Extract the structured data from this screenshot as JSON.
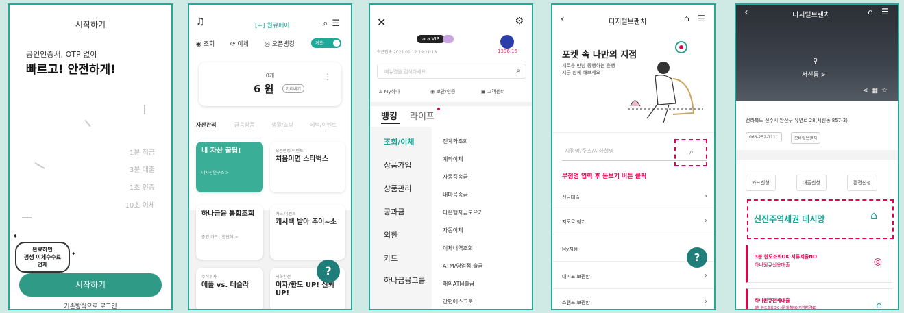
{
  "colors": {
    "accent": "#23a89a",
    "button": "#2f9b87",
    "highlight": "#e0004d",
    "background": "#cfe9e4"
  },
  "screen1": {
    "title": "시작하기",
    "subtitle": "공인인증서, OTP 없이",
    "headline": "빠르고! 안전하게!",
    "timings": [
      "1분 적금",
      "3분 대출",
      "1초 인증",
      "10초 이체"
    ],
    "bubble": [
      "완료하면",
      "평생 이체수수료",
      "면제"
    ],
    "start_button": "시작하기",
    "login_link": "기존방식으로 로그인"
  },
  "screen2": {
    "money_badge": "[+] 원큐페이",
    "nav": [
      "조회",
      "이체",
      "오픈뱅킹"
    ],
    "toggle_label": "계좌",
    "account_count": "0개",
    "amount": "6 원",
    "hide_label": "가리내기",
    "tabs": [
      "자산관리",
      "금융상품",
      "생활/쇼핑",
      "혜택/이벤트"
    ],
    "cards": {
      "asset_title": "내 자산 꿀팁!",
      "asset_sub": "내자산연구소 >",
      "open_small": "오픈뱅킹 이벤트",
      "open_title": "처음이면 스타벅스",
      "hana_title": "하나금융 통합조회",
      "hana_sub": "증권 카드 , 한번에 >",
      "card_small": "카드 이벤트",
      "card_title": "캐시백 받아 주이~소",
      "stock_small": "주식투자",
      "stock_title": "애플 vs. 테슬라",
      "rate_small": "외화환전",
      "rate_title": "이자/한도 UP! 신뢰 UP!"
    },
    "help": "?"
  },
  "screen3": {
    "vip": "ara VIP",
    "last_login": "최근접속 2021.01.12 19:21:18",
    "points": "1336.16",
    "search_placeholder": "메뉴명을 검색하세요",
    "quick": [
      "My하나",
      "보안/인증",
      "고객센터"
    ],
    "main_tabs": [
      "뱅킹",
      "라이프"
    ],
    "categories": [
      "조회/이체",
      "상품가입",
      "상품관리",
      "공과금",
      "외환",
      "카드",
      "하나금융그룹"
    ],
    "subitems": [
      "전계좌조회",
      "계좌이체",
      "자동증송금",
      "내마음송금",
      "타은행자금모으기",
      "자동이체",
      "이체내역조회",
      "ATM/영업점 출금",
      "해외ATM출금",
      "간편에스크로"
    ]
  },
  "screen4": {
    "header": "디지털브랜치",
    "headline": "포켓 속 나만의 지점",
    "sub": [
      "새로운 만남 동행하는 은행",
      "지금 함께 해보세요"
    ],
    "search_placeholder": "지점명/주소/지하철명",
    "note": "부점명 입력 후 돋보기 버튼 클릭",
    "rows": [
      "전금대출",
      "지도로 찾기",
      "My지점",
      "대기표 보관함",
      "스탬프 보관함"
    ],
    "help": "?"
  },
  "screen5": {
    "header": "디지털브랜치",
    "branch": "서신동 >",
    "address": "전라북도 전주시 완산구 유연로 28(서신동 857-3)",
    "pills": [
      "063-252-1111",
      "모바일브랜치"
    ],
    "service_buttons": [
      "카드신청",
      "대출신청",
      "환전신청"
    ],
    "dashed_title": "신진주역세권 데시앙",
    "loan1_line1": "3분 한도조회OK 서류제출NO",
    "loan1_line2": "하나원큐신용대출",
    "loan2_line1": "하나원큐전세대출",
    "loan2_line2": "3분 한도조회OK 서류제출NO 지점방문NO"
  }
}
